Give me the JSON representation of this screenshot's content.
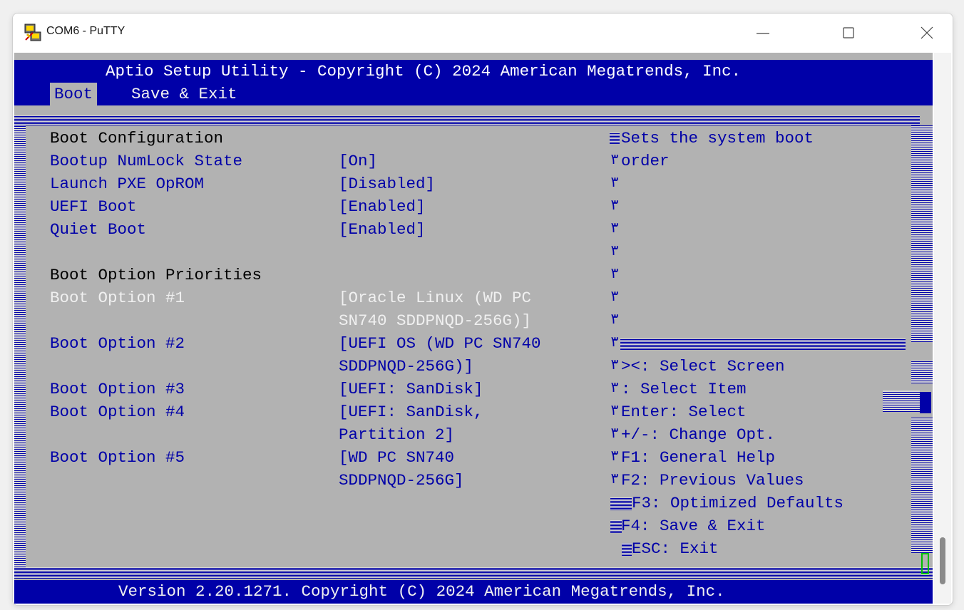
{
  "window": {
    "title": "COM6 - PuTTY",
    "icon": "putty-icon"
  },
  "bios": {
    "header": "Aptio Setup Utility - Copyright (C) 2024 American Megatrends, Inc.",
    "menu": [
      {
        "label": "Boot",
        "selected": true
      },
      {
        "label": "Save & Exit",
        "selected": false
      }
    ],
    "sections": {
      "boot_config": "Boot Configuration",
      "boot_priorities": "Boot Option Priorities"
    },
    "settings": [
      {
        "label": "Bootup NumLock State",
        "value": "[On]"
      },
      {
        "label": "Launch PXE OpROM",
        "value": "[Disabled]"
      },
      {
        "label": "UEFI Boot",
        "value": "[Enabled]"
      },
      {
        "label": "Quiet Boot",
        "value": "[Enabled]"
      }
    ],
    "boot_options": [
      {
        "label": "Boot Option #1",
        "value_lines": [
          "[Oracle Linux (WD PC",
          "SN740 SDDPNQD-256G)]"
        ],
        "highlighted": true
      },
      {
        "label": "Boot Option #2",
        "value_lines": [
          "[UEFI OS (WD PC SN740",
          "SDDPNQD-256G)]"
        ],
        "highlighted": false
      },
      {
        "label": "Boot Option #3",
        "value_lines": [
          "[UEFI: SanDisk]"
        ],
        "highlighted": false
      },
      {
        "label": "Boot Option #4",
        "value_lines": [
          "[UEFI: SanDisk,",
          "Partition 2]"
        ],
        "highlighted": false
      },
      {
        "label": "Boot Option #5",
        "value_lines": [
          "[WD PC SN740",
          "SDDPNQD-256G]"
        ],
        "highlighted": false
      }
    ],
    "help_text": [
      "Sets the system boot",
      "order"
    ],
    "keys": [
      "><: Select Screen",
      ": Select Item",
      "Enter: Select",
      "+/-: Change Opt.",
      "F1: General Help",
      "F2: Previous Values",
      "F3: Optimized Defaults",
      "F4: Save & Exit",
      "ESC: Exit"
    ],
    "border_glyph": "٣",
    "footer": "Version 2.20.1271. Copyright (C) 2024 American Megatrends, Inc.",
    "colors": {
      "background": "#b2b2b2",
      "bar": "#0000a8",
      "text_blue": "#0000a8",
      "text_highlight": "#f0f0f0"
    }
  }
}
